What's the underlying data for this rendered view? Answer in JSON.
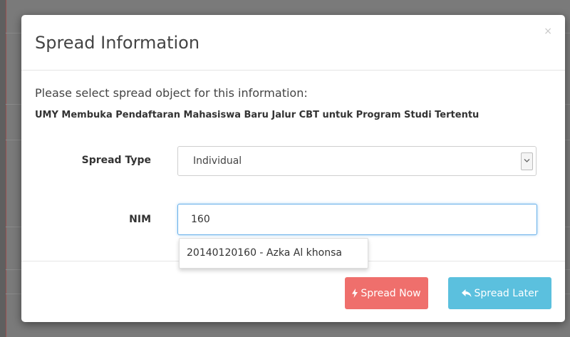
{
  "modal": {
    "title": "Spread Information",
    "close_glyph": "×",
    "intro": "Please select spread object for this information:",
    "info_title": "UMY Membuka Pendaftaran Mahasiswa Baru Jalur CBT untuk Program Studi Tertentu"
  },
  "form": {
    "spread_type_label": "Spread Type",
    "spread_type_value": "Individual",
    "nim_label": "NIM",
    "nim_value": "160"
  },
  "suggestions": [
    "20140120160 - Azka Al khonsa"
  ],
  "buttons": {
    "spread_now": "Spread Now",
    "spread_later": "Spread Later"
  },
  "colors": {
    "danger": "#ef6f6c",
    "info": "#5bc0de",
    "focus": "#66afe9"
  },
  "icons": {
    "spread_now": "bolt-icon",
    "spread_later": "reply-icon",
    "select": "chevron-down-icon"
  }
}
